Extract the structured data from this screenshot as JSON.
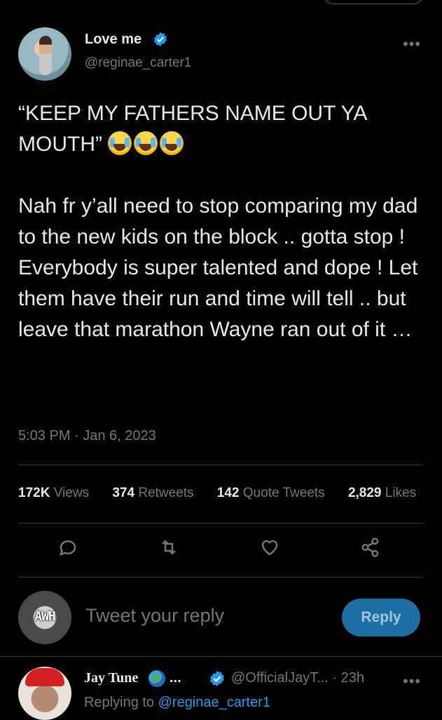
{
  "author": {
    "name": "Love me",
    "handle": "@reginae_carter1",
    "verified": true
  },
  "tweet": {
    "line1": "“KEEP MY FATHERS NAME OUT YA MOUTH”",
    "emojis": [
      "face-with-tears-of-joy",
      "face-with-tears-of-joy",
      "face-with-tears-of-joy"
    ],
    "paragraph2": "Nah fr y’all need to stop comparing my dad to the new kids on the block .. gotta stop ! Everybody is super talented and dope ! Let them have their run and time will tell .. but leave that marathon Wayne ran out of it …",
    "timestamp": "5:03 PM · Jan 6, 2023"
  },
  "stats": {
    "views_count": "172K",
    "views_label": "Views",
    "retweets_count": "374",
    "retweets_label": "Retweets",
    "quotes_count": "142",
    "quotes_label": "Quote Tweets",
    "likes_count": "2,829",
    "likes_label": "Likes"
  },
  "actions": [
    "reply-icon",
    "retweet-icon",
    "like-icon",
    "share-icon"
  ],
  "compose": {
    "avatar_text": "AWH",
    "placeholder": "Tweet your reply",
    "button": "Reply"
  },
  "reply": {
    "name": "Jay Tune",
    "name_suffix": "...",
    "handle_time": "@OfficialJayT... · 23h",
    "replying_prefix": "Replying to ",
    "replying_to": "@reginae_carter1"
  },
  "colors": {
    "background": "#000000",
    "text": "#e7e9ea",
    "muted": "#71767b",
    "accent": "#1d9bf0"
  }
}
